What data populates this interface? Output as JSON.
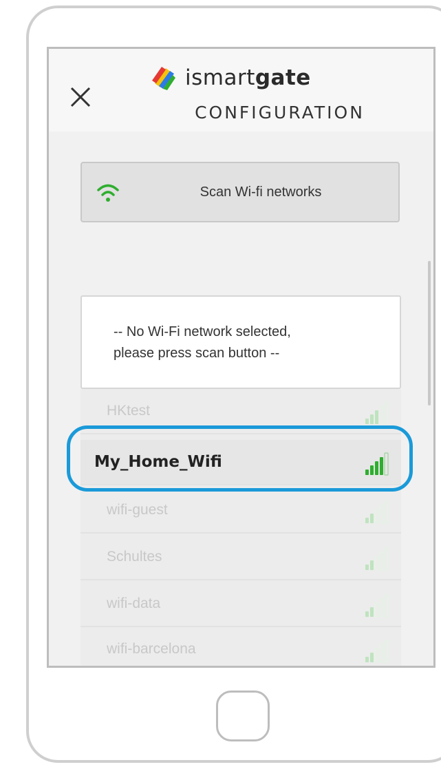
{
  "header": {
    "logo_text_light": "ismart",
    "logo_text_bold": "gate",
    "subtitle": "CONFIGURATION"
  },
  "scan": {
    "label": "Scan Wi-fi networks",
    "icon": "wifi-icon",
    "icon_color": "#2fae2f"
  },
  "notice": {
    "line1": "-- No Wi-Fi network selected,",
    "line2": "please press scan button --"
  },
  "networks": [
    {
      "name": "HKtest",
      "signal": 3
    },
    {
      "name": "My_Home_Wifi",
      "signal": 4,
      "selected": true
    },
    {
      "name": "wifi-guest",
      "signal": 2
    },
    {
      "name": "Schultes",
      "signal": 2
    },
    {
      "name": "wifi-data",
      "signal": 2
    },
    {
      "name": "wifi-barcelona",
      "signal": 2
    }
  ],
  "colors": {
    "highlight": "#1a9ad9",
    "signal_on": "#2fae2f"
  }
}
